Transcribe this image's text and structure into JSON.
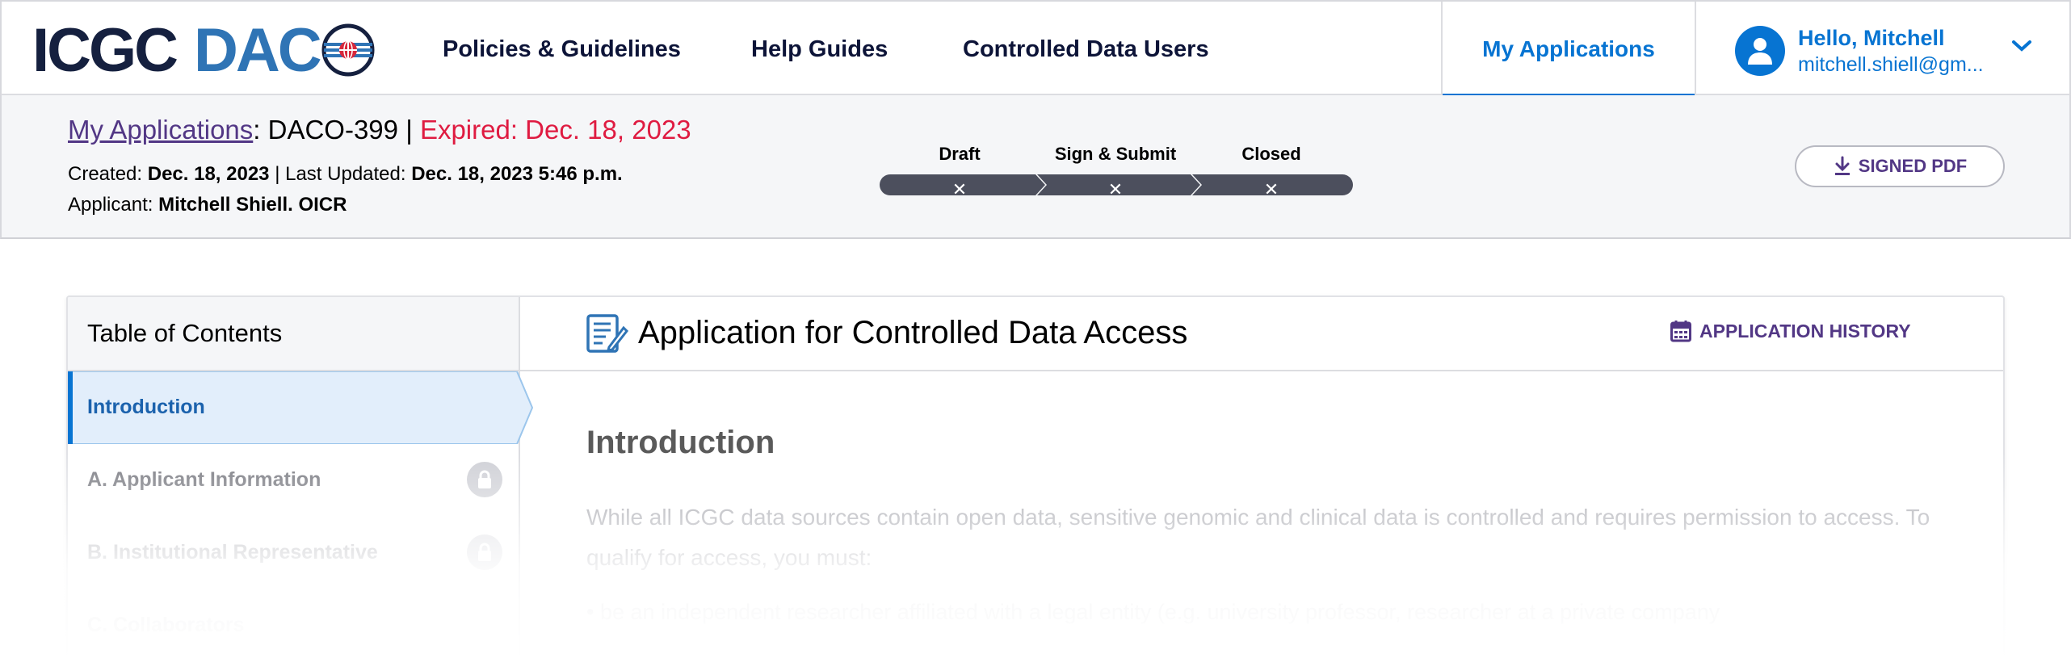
{
  "nav": {
    "logo_icgc": "ICGC",
    "logo_daco": "DAC",
    "links": [
      "Policies & Guidelines",
      "Help Guides",
      "Controlled Data Users"
    ],
    "active_tab": "My Applications",
    "user": {
      "greeting": "Hello, Mitchell",
      "email": "mitchell.shiell@gm..."
    },
    "brand_color": "#0774d2"
  },
  "header": {
    "breadcrumb_link": "My Applications",
    "separator": ":",
    "app_id": "DACO-399",
    "divider": "|",
    "status": "Expired: Dec. 18, 2023",
    "created_label": "Created:",
    "created_value": "Dec. 18, 2023",
    "updated_label": "| Last Updated:",
    "updated_value": "Dec. 18, 2023 5:46 p.m.",
    "applicant_label": "Applicant:",
    "applicant_value": "Mitchell Shiell. OICR",
    "steps": [
      {
        "label": "Draft",
        "mark": "✕"
      },
      {
        "label": "Sign & Submit",
        "mark": "✕"
      },
      {
        "label": "Closed",
        "mark": "✕"
      }
    ],
    "pdf_button": "SIGNED PDF",
    "status_color": "#df1b41"
  },
  "toc": {
    "title": "Table of Contents",
    "items": [
      {
        "label": "Introduction",
        "state": "active"
      },
      {
        "label": "A. Applicant Information",
        "state": "locked"
      },
      {
        "label": "B. Institutional Representative",
        "state": "locked"
      },
      {
        "label": "C. Collaborators",
        "state": "locked"
      }
    ]
  },
  "main": {
    "title": "Application for Controlled Data Access",
    "history_button": "APPLICATION HISTORY",
    "section_heading": "Introduction",
    "paragraph": "While all ICGC data sources contain open data, sensitive genomic and clinical data is controlled and requires permission to access. To qualify for access, you must:",
    "bullet": "• be an independent researcher affiliated with a legal entity (e.g. university professor, researcher at a private company"
  },
  "accent_purple": "#523785"
}
